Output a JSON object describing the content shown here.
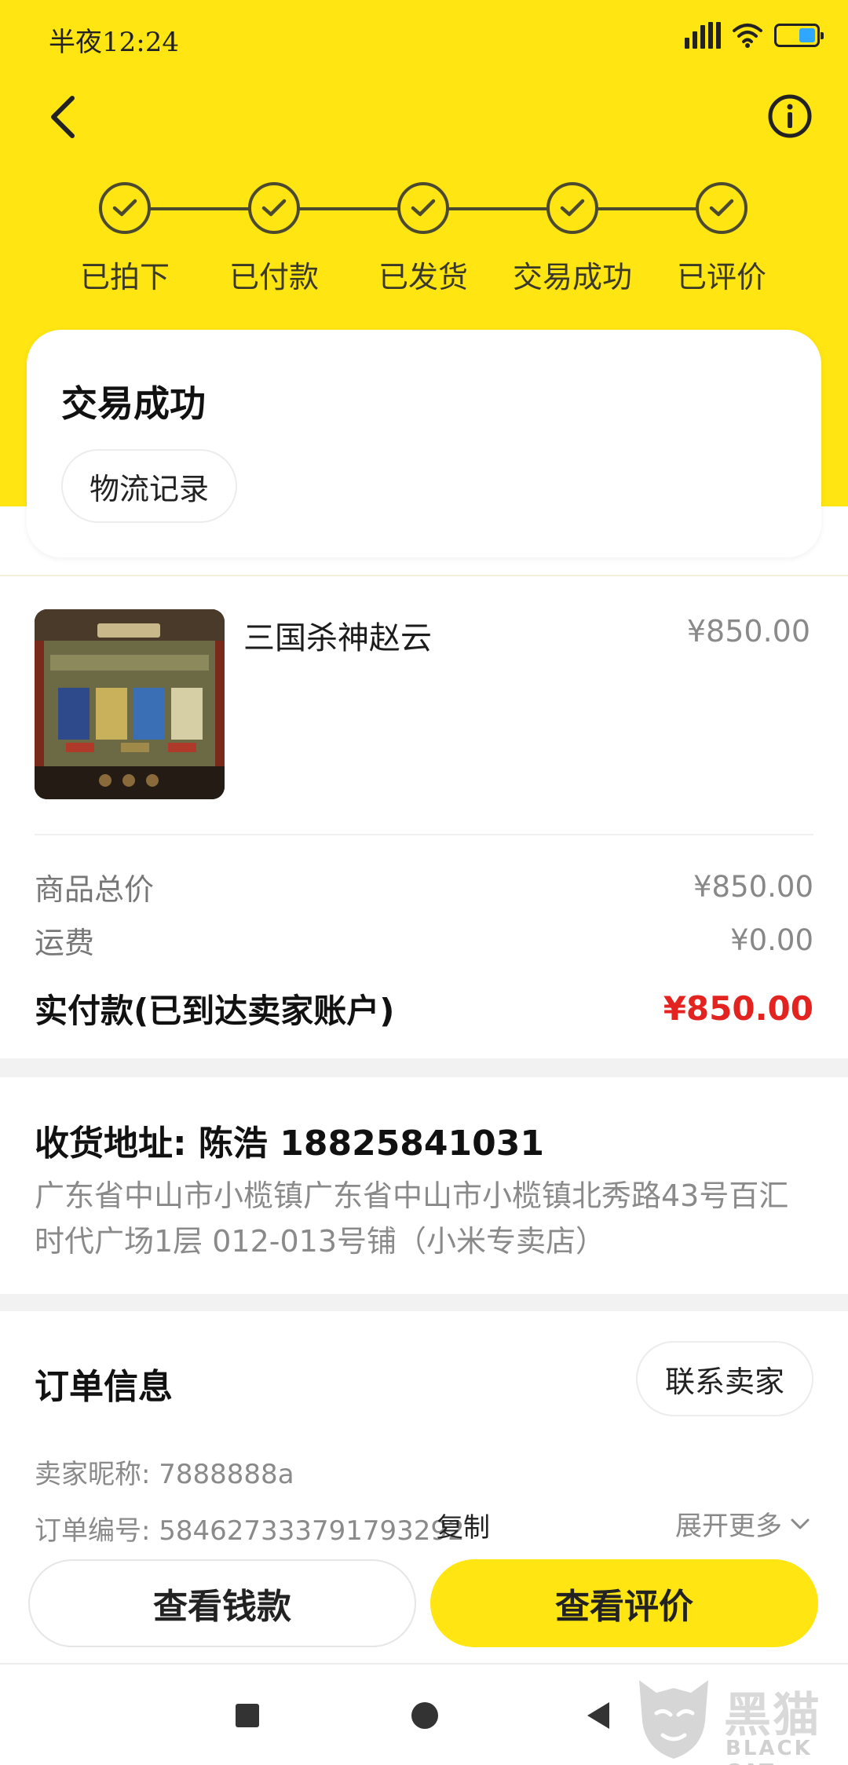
{
  "status_bar": {
    "time": "半夜12:24"
  },
  "steps": [
    {
      "label": "已拍下"
    },
    {
      "label": "已付款"
    },
    {
      "label": "已发货"
    },
    {
      "label": "交易成功"
    },
    {
      "label": "已评价"
    }
  ],
  "status_card": {
    "title": "交易成功",
    "logistics_label": "物流记录"
  },
  "product": {
    "name": "三国杀神赵云",
    "price": "¥850.00"
  },
  "price_summary": {
    "total_label": "商品总价",
    "total_value": "¥850.00",
    "shipping_label": "运费",
    "shipping_value": "¥0.00",
    "paid_label": "实付款(已到达卖家账户)",
    "paid_value": "¥850.00"
  },
  "address": {
    "title": "收货地址:  陈浩  18825841031",
    "body": "广东省中山市小榄镇广东省中山市小榄镇北秀路43号百汇时代广场1层  012-013号铺（小米专卖店）"
  },
  "order_info": {
    "title": "订单信息",
    "contact_seller_label": "联系卖家",
    "seller_nick_label": "卖家昵称: ",
    "seller_nick_value": "7888888a",
    "order_no_label": "订单编号: ",
    "order_no_value": "584627333791793292",
    "copy_label": "复制",
    "expand_label": "展开更多"
  },
  "actions": {
    "view_money": "查看钱款",
    "view_review": "查看评价"
  },
  "watermark": {
    "text": "黑猫",
    "sub": "BLACK CAT"
  },
  "colors": {
    "accent_yellow": "#ffe512",
    "price_red": "#e3231f"
  }
}
